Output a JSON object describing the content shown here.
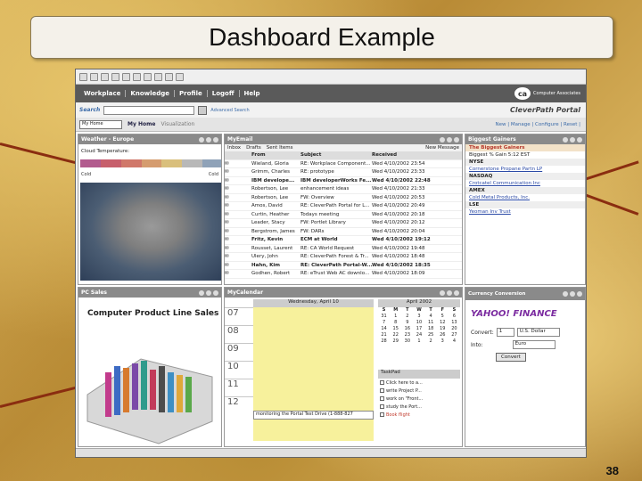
{
  "slide": {
    "title": "Dashboard Example",
    "page_number": "38"
  },
  "portal": {
    "nav": [
      "Workplace",
      "Knowledge",
      "Profile",
      "Logoff",
      "Help"
    ],
    "brand_small": "Computer Associates",
    "brand": "CleverPath Portal",
    "search_label": "Search",
    "advanced_search": "Advanced Search",
    "home_select": "My Home",
    "tabs": [
      "My Home",
      "Visualization"
    ],
    "toolbar_links": "New | Manage | Configure | Reset |"
  },
  "weather": {
    "title": "Weather - Europe",
    "legend": "Cloud Temperature:",
    "cold_left": "Cold",
    "cold_right": "Cold"
  },
  "email": {
    "title": "MyEmail",
    "toolbar": [
      "Inbox",
      "Drafts",
      "Sent Items"
    ],
    "new_message": "New Message",
    "headers": [
      "From",
      "Subject",
      "Received"
    ],
    "rows": [
      {
        "from": "Wieland, Gloria",
        "subject": "RE: Workplace Component...",
        "received": "Wed 4/10/2002 23:54",
        "bold": false
      },
      {
        "from": "Grimm, Charles",
        "subject": "RE: prototype",
        "received": "Wed 4/10/2002 23:33",
        "bold": false
      },
      {
        "from": "IBM develope...",
        "subject": "IBM developerWorks Fe...",
        "received": "Wed 4/10/2002 22:48",
        "bold": true
      },
      {
        "from": "Robertson, Lee",
        "subject": "enhancement ideas",
        "received": "Wed 4/10/2002 21:33",
        "bold": false
      },
      {
        "from": "Robertson, Lee",
        "subject": "FW: Overview",
        "received": "Wed 4/10/2002 20:53",
        "bold": false
      },
      {
        "from": "Amos, David",
        "subject": "RE: CleverPath Portal for L...",
        "received": "Wed 4/10/2002 20:49",
        "bold": false
      },
      {
        "from": "Curtin, Heather",
        "subject": "Todays meeting",
        "received": "Wed 4/10/2002 20:18",
        "bold": false
      },
      {
        "from": "Leader, Stacy",
        "subject": "FW: Portlet Library",
        "received": "Wed 4/10/2002 20:12",
        "bold": false
      },
      {
        "from": "Bergstrom, James",
        "subject": "FW: DARs",
        "received": "Wed 4/10/2002 20:04",
        "bold": false
      },
      {
        "from": "Fritz, Kevin",
        "subject": "ECM at World",
        "received": "Wed 4/10/2002 19:12",
        "bold": true
      },
      {
        "from": "Rousset, Laurent",
        "subject": "RE: CA World Request",
        "received": "Wed 4/10/2002 19:48",
        "bold": false
      },
      {
        "from": "Ulery, John",
        "subject": "RE: CleverPath Forest & Tr...",
        "received": "Wed 4/10/2002 18:48",
        "bold": false
      },
      {
        "from": "Hahn, Kim",
        "subject": "RE: CleverPath Portal-W...",
        "received": "Wed 4/10/2002 18:35",
        "bold": true
      },
      {
        "from": "Godhen, Robert",
        "subject": "RE: eTrust Web AC downlo...",
        "received": "Wed 4/10/2002 18:09",
        "bold": false
      }
    ]
  },
  "gainers": {
    "title": "Biggest Gainers",
    "header": "The Biggest Gainers",
    "subheader": "Biggest % Gain   5:12 EST",
    "sections": [
      {
        "exchange": "NYSE",
        "items": [
          "Cornerstone Propane Partn LP"
        ]
      },
      {
        "exchange": "NASDAQ",
        "items": [
          "Crotcatel Communication Inc"
        ]
      },
      {
        "exchange": "AMEX",
        "items": [
          "Cold Metal Products, Inc."
        ]
      },
      {
        "exchange": "LSE",
        "items": [
          "Yeoman Inv Trust"
        ]
      }
    ]
  },
  "sales": {
    "title": "PC Sales",
    "chart_title": "Computer Product Line Sales"
  },
  "calendar": {
    "title": "MyCalendar",
    "date": "Wednesday, April 10",
    "hours": [
      "07",
      "08",
      "09",
      "10",
      "11",
      "12"
    ],
    "event": "monitoring the Portal Test Drive (1-888-827",
    "month": "April 2002",
    "weekdays": [
      "S",
      "M",
      "T",
      "W",
      "T",
      "F",
      "S"
    ],
    "days": [
      "31",
      "1",
      "2",
      "3",
      "4",
      "5",
      "6",
      "7",
      "8",
      "9",
      "10",
      "11",
      "12",
      "13",
      "14",
      "15",
      "16",
      "17",
      "18",
      "19",
      "20",
      "21",
      "22",
      "23",
      "24",
      "25",
      "26",
      "27",
      "28",
      "29",
      "30",
      "1",
      "2",
      "3",
      "4"
    ],
    "taskpad": "TaskPad",
    "tasks": [
      "Click here to a...",
      "write Project P...",
      "work on \"Front...",
      "study the Port...",
      "Book flight"
    ]
  },
  "currency": {
    "title": "Currency Conversion",
    "logo": "YAHOO! FINANCE",
    "convert_label": "Convert:",
    "amount": "1",
    "from": "U.S. Dollar",
    "into_label": "Into:",
    "to": "Euro",
    "button": "Convert"
  }
}
